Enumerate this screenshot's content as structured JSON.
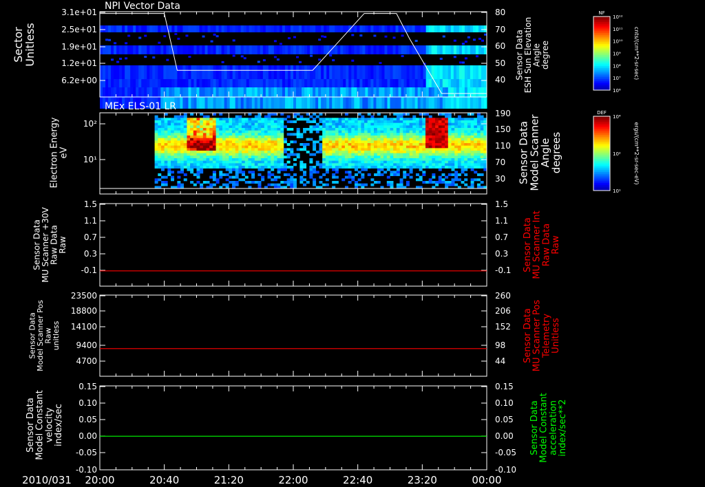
{
  "window": {
    "date_label": "2010/031"
  },
  "time_axis": {
    "ticks": [
      "20:00",
      "20:40",
      "21:20",
      "22:00",
      "22:40",
      "23:20",
      "00:00"
    ]
  },
  "colors": {
    "background": "#000000",
    "axis": "#ffffff",
    "red_trace": "#ff0000",
    "green_trace": "#00ff00"
  },
  "chart_data": [
    {
      "type": "heatmap",
      "id": "npi",
      "title": "NPI Vector Data",
      "ylabel": [
        "Sector",
        "Unitless"
      ],
      "y_ticks": [
        "3.1e+01",
        "2.5e+01",
        "1.9e+01",
        "1.2e+01",
        "6.2e+00"
      ],
      "right_ylabel": [
        "Sensor Data",
        "ESH Sun Elevation",
        "Angle",
        "degree"
      ],
      "right_ticks": [
        "80",
        "70",
        "60",
        "50",
        "40"
      ],
      "right_ylim": [
        32,
        80
      ],
      "overlay_series": {
        "x": [
          "20:00",
          "20:40",
          "20:48",
          "21:52",
          "22:12",
          "22:20",
          "22:44",
          "23:04",
          "23:12",
          "23:32",
          "00:00"
        ],
        "y": [
          79,
          79,
          47,
          47,
          47,
          55,
          79,
          79,
          65,
          34,
          34
        ]
      },
      "colorbar": {
        "title": "NF",
        "units": "cnts/(cm**2-sr-sec)",
        "ticks": [
          "10¹²",
          "10¹¹",
          "10¹⁰",
          "10⁹",
          "10⁸",
          "10⁷",
          "10⁶"
        ]
      }
    },
    {
      "type": "heatmap",
      "id": "els",
      "title": "MEx ELS-01 LR",
      "ylabel": [
        "Electron Energy",
        "eV"
      ],
      "y_ticks": [
        "10²",
        "10¹"
      ],
      "right_ylabel": [
        "Sensor Data",
        "Model Scanner",
        "Angle",
        "degrees"
      ],
      "right_ticks": [
        "190",
        "150",
        "110",
        "70",
        "30"
      ],
      "colorbar": {
        "title": "DEF",
        "units": "ergs/(cm**2-sr-sec-eV)",
        "ticks": [
          "10⁴",
          "10²",
          "10¹"
        ]
      }
    },
    {
      "type": "line",
      "id": "mu_int",
      "ylabel": [
        "Sensor Data",
        "MU Scanner +30V",
        "Raw Data",
        "Raw"
      ],
      "y_ticks": [
        "1.5",
        "1.1",
        "0.7",
        "0.3",
        "-0.1"
      ],
      "ylim": [
        -0.34,
        1.5
      ],
      "right_ylabel": [
        "Sensor Data",
        "MU Scanner Int",
        "Raw Data",
        "Raw"
      ],
      "right_ticks": [
        "1.5",
        "1.1",
        "0.7",
        "0.3",
        "-0.1"
      ],
      "series": [
        {
          "color": "red",
          "x": [
            "20:00",
            "00:00"
          ],
          "y": [
            0.0,
            0.0
          ]
        }
      ]
    },
    {
      "type": "line",
      "id": "scanner_pos",
      "ylabel": [
        "Sensor Data",
        "Model Scanner Pos",
        "Raw",
        "unitless"
      ],
      "y_ticks": [
        "23500",
        "18800",
        "14100",
        "9400",
        "4700"
      ],
      "ylim": [
        0,
        23500
      ],
      "right_ylabel": [
        "Sensor Data",
        "MU Scanner Pos",
        "Telemetry",
        "Unitless"
      ],
      "right_ticks": [
        "260",
        "206",
        "152",
        "98",
        "44"
      ],
      "series": [
        {
          "color": "red",
          "x": [
            "20:00",
            "00:00"
          ],
          "y": [
            8000,
            8000
          ]
        }
      ]
    },
    {
      "type": "line",
      "id": "model_const",
      "ylabel": [
        "Sensor Data",
        "Model Constant",
        "velocity",
        "index/sec"
      ],
      "y_ticks": [
        "0.15",
        "0.10",
        "0.05",
        "0.00",
        "-0.05",
        "-0.10"
      ],
      "ylim": [
        -0.1,
        0.15
      ],
      "right_ylabel": [
        "Sensor Data",
        "Model Constant",
        "acceleration",
        "index/sec**2"
      ],
      "right_ticks": [
        "0.15",
        "0.10",
        "0.05",
        "0.00",
        "-0.05",
        "-0.10"
      ],
      "series": [
        {
          "color": "green",
          "x": [
            "20:00",
            "00:00"
          ],
          "y": [
            0.0,
            0.0
          ]
        }
      ]
    }
  ]
}
